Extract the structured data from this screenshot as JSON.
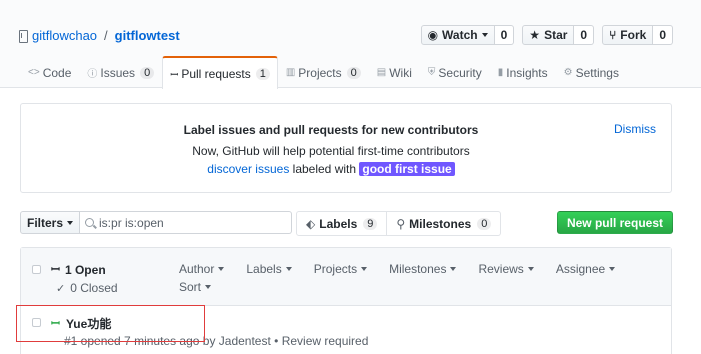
{
  "repo": {
    "owner": "gitflowchao",
    "separator": "/",
    "name": "gitflowtest"
  },
  "actions": {
    "watch": {
      "label": "Watch",
      "icon": "eye-icon",
      "count": "0"
    },
    "star": {
      "label": "Star",
      "icon": "star-icon",
      "count": "0"
    },
    "fork": {
      "label": "Fork",
      "icon": "fork-icon",
      "count": "0"
    }
  },
  "nav": {
    "code": {
      "label": "Code"
    },
    "issues": {
      "label": "Issues",
      "count": "0"
    },
    "pulls": {
      "label": "Pull requests",
      "count": "1"
    },
    "projects": {
      "label": "Projects",
      "count": "0"
    },
    "wiki": {
      "label": "Wiki"
    },
    "security": {
      "label": "Security"
    },
    "insights": {
      "label": "Insights"
    },
    "settings": {
      "label": "Settings"
    }
  },
  "banner": {
    "title": "Label issues and pull requests for new contributors",
    "line1": "Now, GitHub will help potential first-time contributors",
    "link": "discover issues",
    "middle": "labeled with",
    "label": "good first issue",
    "label_color": "#7057ff",
    "dismiss": "Dismiss"
  },
  "filters": {
    "button": "Filters",
    "search_value": "is:pr is:open",
    "labels": {
      "label": "Labels",
      "count": "9"
    },
    "milestones": {
      "label": "Milestones",
      "count": "0"
    },
    "new_pr": "New pull request"
  },
  "list": {
    "open": "1 Open",
    "closed": "0 Closed",
    "sort": [
      "Author",
      "Labels",
      "Projects",
      "Milestones",
      "Reviews",
      "Assignee",
      "Sort"
    ]
  },
  "issues": [
    {
      "title": "Yue功能",
      "meta": "#1 opened 7 minutes ago by Jadentest • Review required"
    }
  ]
}
